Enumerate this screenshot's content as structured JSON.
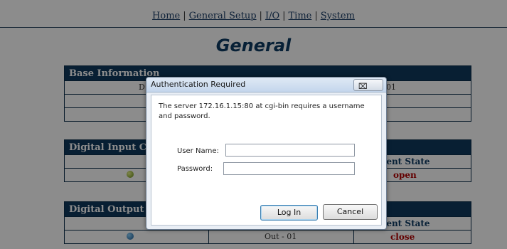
{
  "nav": {
    "items": [
      "Home",
      "General Setup",
      "I/O",
      "Time",
      "System"
    ],
    "separator": "|"
  },
  "page_title": "General",
  "sections": {
    "base": {
      "header": "Base Information",
      "partial_left": "D",
      "partial_right": "01"
    },
    "digital_input": {
      "header": "Digital Input C",
      "col_header": "rent State",
      "state": "open"
    },
    "digital_output": {
      "header": "Digital Output",
      "col_header": "rent State",
      "channel": "Out - 01",
      "state": "close"
    }
  },
  "dialog": {
    "title": "Authentication Required",
    "close_glyph": "⌧",
    "message": "The server 172.16.1.15:80 at cgi-bin requires a username and password.",
    "username_label": "User Name:",
    "username_value": "",
    "password_label": "Password:",
    "password_value": "",
    "login_label": "Log In",
    "cancel_label": "Cancel"
  },
  "colors": {
    "header_bg": "#0f3a5e",
    "state_red": "#b40000",
    "nav_link": "#1a3d66"
  }
}
